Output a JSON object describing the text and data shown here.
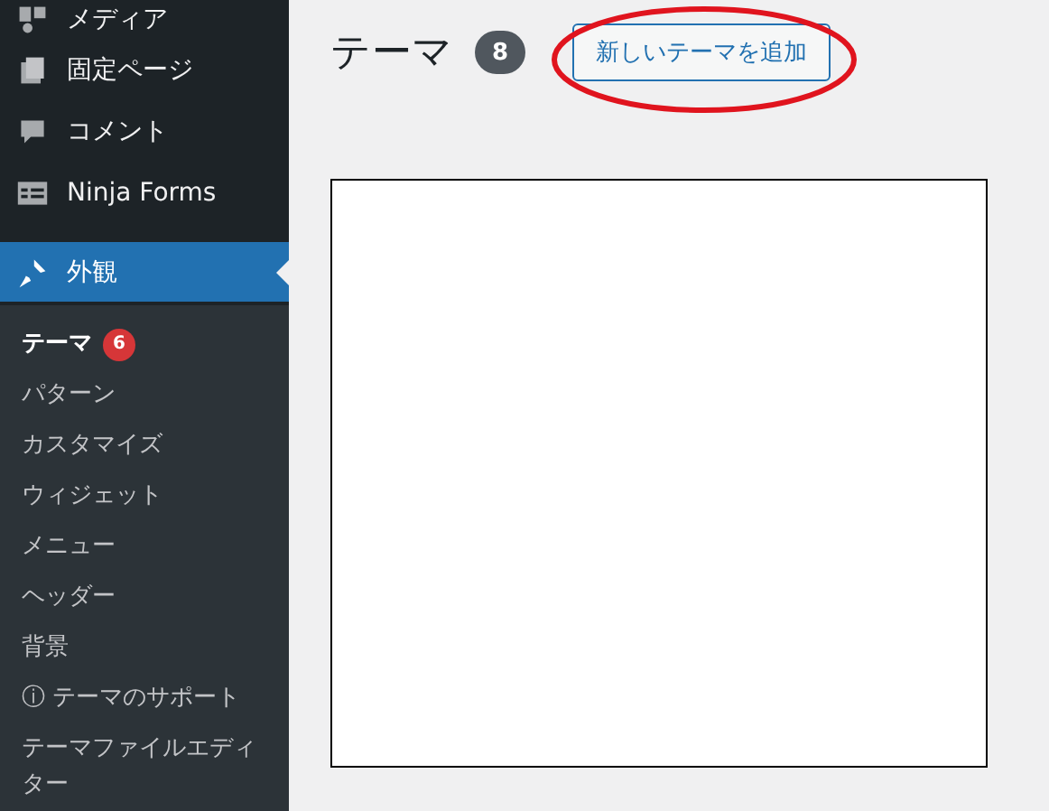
{
  "sidebar": {
    "items": [
      {
        "label": "メディア",
        "selected": false
      },
      {
        "label": "固定ページ",
        "selected": false
      },
      {
        "label": "コメント",
        "selected": false
      },
      {
        "label": "Ninja Forms",
        "selected": false
      },
      {
        "label": "外観",
        "selected": true
      }
    ],
    "submenu": [
      {
        "label": "テーマ",
        "selected": true,
        "badge": "6"
      },
      {
        "label": "パターン",
        "selected": false
      },
      {
        "label": "カスタマイズ",
        "selected": false
      },
      {
        "label": "ウィジェット",
        "selected": false
      },
      {
        "label": "メニュー",
        "selected": false
      },
      {
        "label": "ヘッダー",
        "selected": false
      },
      {
        "label": "背景",
        "selected": false
      },
      {
        "label": "ⓘ テーマのサポート",
        "selected": false
      },
      {
        "label": "テーマファイルエディター",
        "selected": false
      }
    ]
  },
  "header": {
    "title": "テーマ",
    "count": "8",
    "add_button": "新しいテーマを追加"
  }
}
